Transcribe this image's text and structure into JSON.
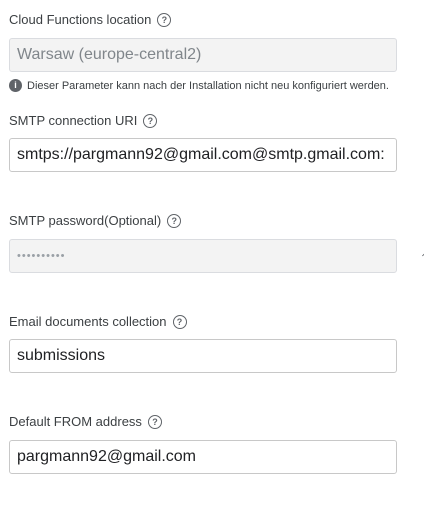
{
  "cloud_functions": {
    "label": "Cloud Functions location",
    "value": "Warsaw (europe-central2)",
    "note": "Dieser Parameter kann nach der Installation nicht neu konfiguriert werden."
  },
  "smtp_uri": {
    "label": "SMTP connection URI",
    "value": "smtps://pargmann92@gmail.com@smtp.gmail.com:"
  },
  "smtp_password": {
    "label": "SMTP password(Optional)",
    "value": "••••••••••"
  },
  "email_collection": {
    "label": "Email documents collection",
    "value": "submissions"
  },
  "default_from": {
    "label": "Default FROM address",
    "value": "pargmann92@gmail.com"
  },
  "icons": {
    "help": "?",
    "info": "i",
    "edge": "⌃"
  }
}
